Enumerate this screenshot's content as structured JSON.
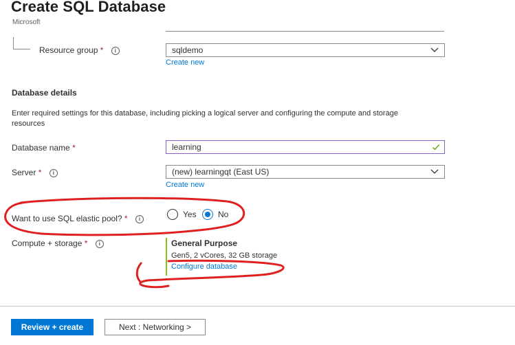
{
  "page": {
    "title": "Create SQL Database",
    "publisher": "Microsoft"
  },
  "resource_group": {
    "label": "Resource group",
    "required_mark": "*",
    "value": "sqldemo",
    "create_new": "Create new"
  },
  "database_details": {
    "heading": "Database details",
    "description": "Enter required settings for this database, including picking a logical server and configuring the compute and storage resources"
  },
  "database_name": {
    "label": "Database name",
    "required_mark": "*",
    "value": "learning",
    "valid": true
  },
  "server": {
    "label": "Server",
    "required_mark": "*",
    "value": "(new) learningqt (East US)",
    "create_new": "Create new"
  },
  "elastic_pool": {
    "label": "Want to use SQL elastic pool?",
    "required_mark": "*",
    "options": [
      "Yes",
      "No"
    ],
    "selected": "No"
  },
  "compute_storage": {
    "label": "Compute + storage",
    "required_mark": "*",
    "tier": "General Purpose",
    "spec": "Gen5, 2 vCores, 32 GB storage",
    "configure_link": "Configure database"
  },
  "footer": {
    "review_create": "Review + create",
    "next": "Next : Networking >"
  },
  "colors": {
    "accent": "#0078d4",
    "required": "#a4262c",
    "tier_bar": "#8cbd18",
    "annotation": "#e02020",
    "valid_check": "#57a300"
  },
  "icons": {
    "info": "info-icon",
    "chevron": "chevron-down-icon",
    "check": "checkmark-icon"
  }
}
